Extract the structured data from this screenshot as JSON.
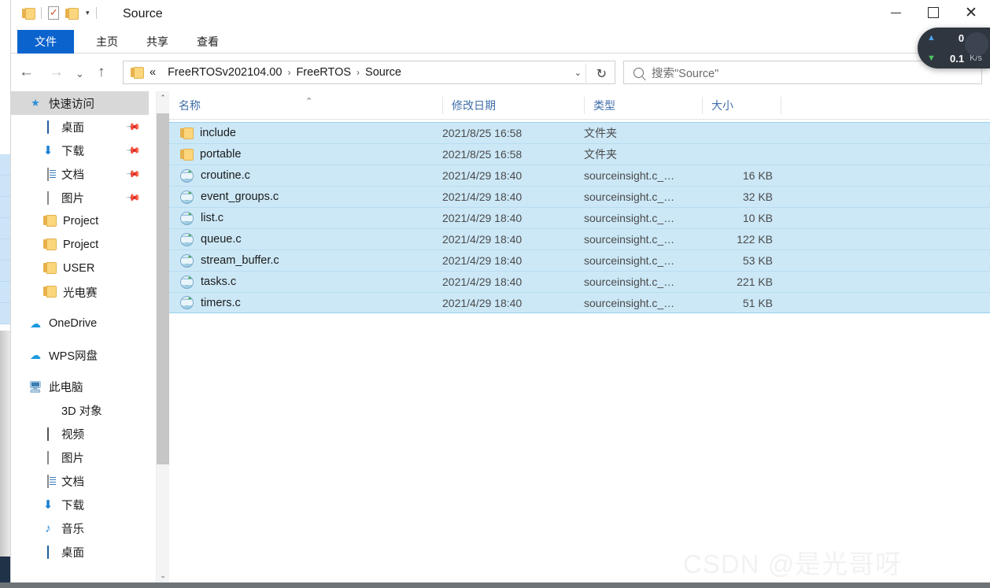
{
  "window": {
    "title": "Source",
    "quick_access_toolbar": [
      {
        "name": "folder-icon",
        "label": ""
      },
      {
        "name": "properties-icon",
        "label": ""
      },
      {
        "name": "new-folder-icon",
        "label": ""
      },
      {
        "name": "customize-caret-icon",
        "label": "▾"
      }
    ],
    "controls": {
      "minimize": "—",
      "maximize": "▢",
      "close": "✕"
    }
  },
  "ribbon": {
    "tabs": [
      {
        "label": "文件",
        "active": true
      },
      {
        "label": "主页",
        "active": false
      },
      {
        "label": "共享",
        "active": false
      },
      {
        "label": "查看",
        "active": false
      }
    ]
  },
  "navigation": {
    "back": "←",
    "forward": "→",
    "recent_caret": "⌄",
    "up": "↑",
    "breadcrumb_prefix": "«",
    "breadcrumbs": [
      "FreeRTOSv202104.00",
      "FreeRTOS",
      "Source"
    ],
    "breadcrumb_separator": "›",
    "address_dropdown": "⌄",
    "refresh": "↻"
  },
  "search": {
    "icon": "search-icon",
    "placeholder": "搜索\"Source\""
  },
  "sidebar": {
    "items": [
      {
        "label": "快速访问",
        "icon": "star-pin-icon",
        "selected": true,
        "pinned": false,
        "indent": 0
      },
      {
        "label": "桌面",
        "icon": "desktop-icon",
        "selected": false,
        "pinned": true,
        "indent": 1
      },
      {
        "label": "下载",
        "icon": "download-icon",
        "selected": false,
        "pinned": true,
        "indent": 1
      },
      {
        "label": "文档",
        "icon": "documents-icon",
        "selected": false,
        "pinned": true,
        "indent": 1
      },
      {
        "label": "图片",
        "icon": "pictures-icon",
        "selected": false,
        "pinned": true,
        "indent": 1
      },
      {
        "label": "Project",
        "icon": "folder-icon",
        "selected": false,
        "pinned": false,
        "indent": 1
      },
      {
        "label": "Project",
        "icon": "folder-icon",
        "selected": false,
        "pinned": false,
        "indent": 1
      },
      {
        "label": "USER",
        "icon": "folder-icon",
        "selected": false,
        "pinned": false,
        "indent": 1
      },
      {
        "label": "光电赛",
        "icon": "folder-icon",
        "selected": false,
        "pinned": false,
        "indent": 1
      },
      {
        "label": "OneDrive",
        "icon": "cloud-icon",
        "selected": false,
        "pinned": false,
        "indent": 0,
        "gap_before": true
      },
      {
        "label": "WPS网盘",
        "icon": "cloud-icon",
        "selected": false,
        "pinned": false,
        "indent": 0,
        "gap_before": true
      },
      {
        "label": "此电脑",
        "icon": "this-pc-icon",
        "selected": false,
        "pinned": false,
        "indent": 0,
        "gap_before": true
      },
      {
        "label": "3D 对象",
        "icon": "3d-objects-icon",
        "selected": false,
        "pinned": false,
        "indent": 1
      },
      {
        "label": "视频",
        "icon": "videos-icon",
        "selected": false,
        "pinned": false,
        "indent": 1
      },
      {
        "label": "图片",
        "icon": "pictures-icon",
        "selected": false,
        "pinned": false,
        "indent": 1
      },
      {
        "label": "文档",
        "icon": "documents-icon",
        "selected": false,
        "pinned": false,
        "indent": 1
      },
      {
        "label": "下载",
        "icon": "download-icon",
        "selected": false,
        "pinned": false,
        "indent": 1
      },
      {
        "label": "音乐",
        "icon": "music-icon",
        "selected": false,
        "pinned": false,
        "indent": 1
      },
      {
        "label": "桌面",
        "icon": "desktop-icon",
        "selected": false,
        "pinned": false,
        "indent": 1
      }
    ],
    "scrollbar": {
      "up_arrow": "⌃",
      "down_arrow": "⌄"
    }
  },
  "file_list": {
    "columns": [
      {
        "label": "名称",
        "sorted": "asc",
        "sort_indicator": "⌃"
      },
      {
        "label": "修改日期",
        "sorted": null
      },
      {
        "label": "类型",
        "sorted": null
      },
      {
        "label": "大小",
        "sorted": null
      }
    ],
    "rows": [
      {
        "name": "include",
        "date": "2021/8/25 16:58",
        "type": "文件夹",
        "size": "",
        "icon": "folder-icon",
        "selected": true
      },
      {
        "name": "portable",
        "date": "2021/8/25 16:58",
        "type": "文件夹",
        "size": "",
        "icon": "folder-icon",
        "selected": true
      },
      {
        "name": "croutine.c",
        "date": "2021/4/29 18:40",
        "type": "sourceinsight.c_…",
        "size": "16 KB",
        "icon": "c-source-icon",
        "selected": true
      },
      {
        "name": "event_groups.c",
        "date": "2021/4/29 18:40",
        "type": "sourceinsight.c_…",
        "size": "32 KB",
        "icon": "c-source-icon",
        "selected": true
      },
      {
        "name": "list.c",
        "date": "2021/4/29 18:40",
        "type": "sourceinsight.c_…",
        "size": "10 KB",
        "icon": "c-source-icon",
        "selected": true
      },
      {
        "name": "queue.c",
        "date": "2021/4/29 18:40",
        "type": "sourceinsight.c_…",
        "size": "122 KB",
        "icon": "c-source-icon",
        "selected": true
      },
      {
        "name": "stream_buffer.c",
        "date": "2021/4/29 18:40",
        "type": "sourceinsight.c_…",
        "size": "53 KB",
        "icon": "c-source-icon",
        "selected": true
      },
      {
        "name": "tasks.c",
        "date": "2021/4/29 18:40",
        "type": "sourceinsight.c_…",
        "size": "221 KB",
        "icon": "c-source-icon",
        "selected": true
      },
      {
        "name": "timers.c",
        "date": "2021/4/29 18:40",
        "type": "sourceinsight.c_…",
        "size": "51 KB",
        "icon": "c-source-icon",
        "selected": true
      }
    ]
  },
  "network_widget": {
    "upload": {
      "icon": "arrow-up-icon",
      "value": "0",
      "unit": "K/s"
    },
    "download": {
      "icon": "arrow-down-icon",
      "value": "0.1",
      "unit": "K/s"
    }
  },
  "watermark": {
    "text": "CSDN @是光哥呀"
  },
  "colors": {
    "accent": "#0b63ce",
    "selection": "#cce8f7",
    "column_header_text": "#3f6ea8",
    "widget_bg": "#2f3640"
  }
}
